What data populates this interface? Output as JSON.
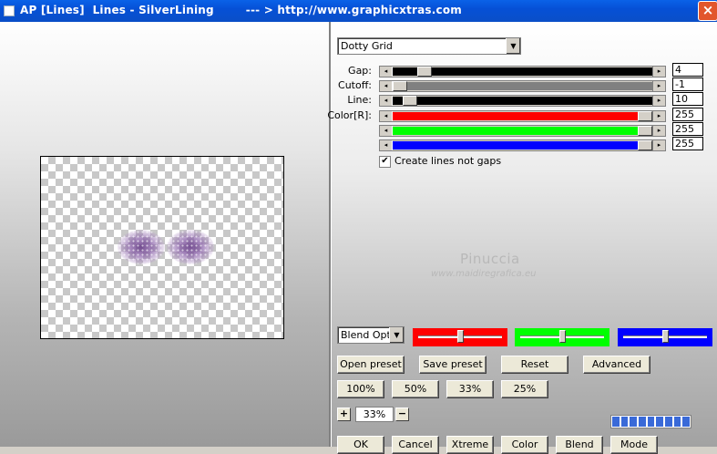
{
  "window": {
    "title": "AP [Lines]  Lines - SilverLining        --- > http://www.graphicxtras.com",
    "close_label": "×"
  },
  "preset_combo": {
    "value": "Dotty Grid"
  },
  "sliders": [
    {
      "label": "Gap:",
      "value": "4",
      "fill_color": "#000000",
      "level": 0.1
    },
    {
      "label": "Cutoff:",
      "value": "-1",
      "fill_color": "#808080",
      "level": 0.0
    },
    {
      "label": "Line:",
      "value": "10",
      "fill_color": "#000000",
      "level": 0.04
    },
    {
      "label": "Color[R]:",
      "value": "255",
      "fill_color": "#ff0000",
      "level": 1.0
    },
    {
      "label": "",
      "value": "255",
      "fill_color": "#00ff00",
      "level": 1.0
    },
    {
      "label": "",
      "value": "255",
      "fill_color": "#0000ff",
      "level": 1.0
    }
  ],
  "checkbox": {
    "label": "Create lines not gaps",
    "checked": true,
    "mark": "✔"
  },
  "watermark": {
    "name": "Pinuccia",
    "site": "www.maidiregrafica.eu"
  },
  "blend_combo": {
    "value": "Blend Optio"
  },
  "color_boxes": [
    {
      "color": "#ff0000",
      "level": 0.5
    },
    {
      "color": "#00ff00",
      "level": 0.5
    },
    {
      "color": "#0000ff",
      "level": 0.5
    }
  ],
  "buttons": {
    "open_preset": "Open preset",
    "save_preset": "Save preset",
    "reset": "Reset",
    "advanced": "Advanced",
    "zoom100": "100%",
    "zoom50": "50%",
    "zoom33": "33%",
    "zoom25": "25%",
    "ok": "OK",
    "cancel": "Cancel",
    "xtreme": "Xtreme",
    "color": "Color",
    "blend": "Blend",
    "mode": "Mode"
  },
  "zoom": {
    "value": "33%",
    "plus": "+",
    "minus": "−"
  },
  "arrows": {
    "left": "◂",
    "right": "▸",
    "down": "▼"
  }
}
